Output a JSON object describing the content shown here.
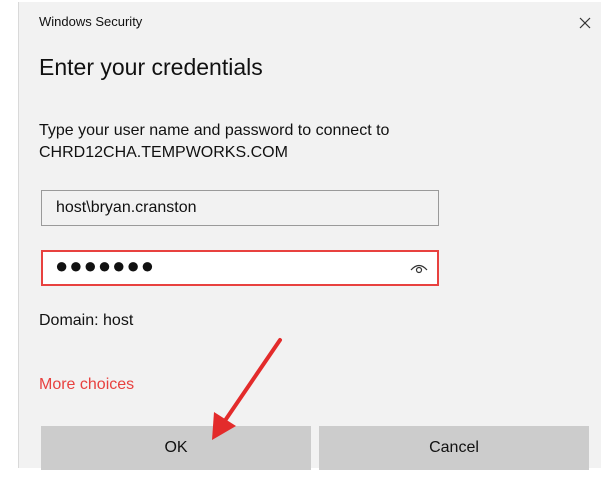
{
  "window": {
    "title": "Windows Security",
    "close_icon": "close-icon"
  },
  "dialog": {
    "heading": "Enter your credentials",
    "message_line1": "Type your user name and password to connect to",
    "message_line2": "CHRD12CHA.TEMPWORKS.COM"
  },
  "username_field": {
    "value": "host\\bryan.cranston"
  },
  "password_field": {
    "masked_value": "●●●●●●●",
    "reveal_icon": "eye-icon",
    "border_color": "#e8413f"
  },
  "domain_text": "Domain: host",
  "more_choices_link": "More choices",
  "buttons": {
    "ok": "OK",
    "cancel": "Cancel"
  },
  "annotation": {
    "icon": "red-arrow-annotation",
    "color": "#e32b2b"
  },
  "colors": {
    "dialog_bg": "#f2f2f2",
    "accent_red": "#e8413f",
    "button_bg": "#cccccc"
  }
}
